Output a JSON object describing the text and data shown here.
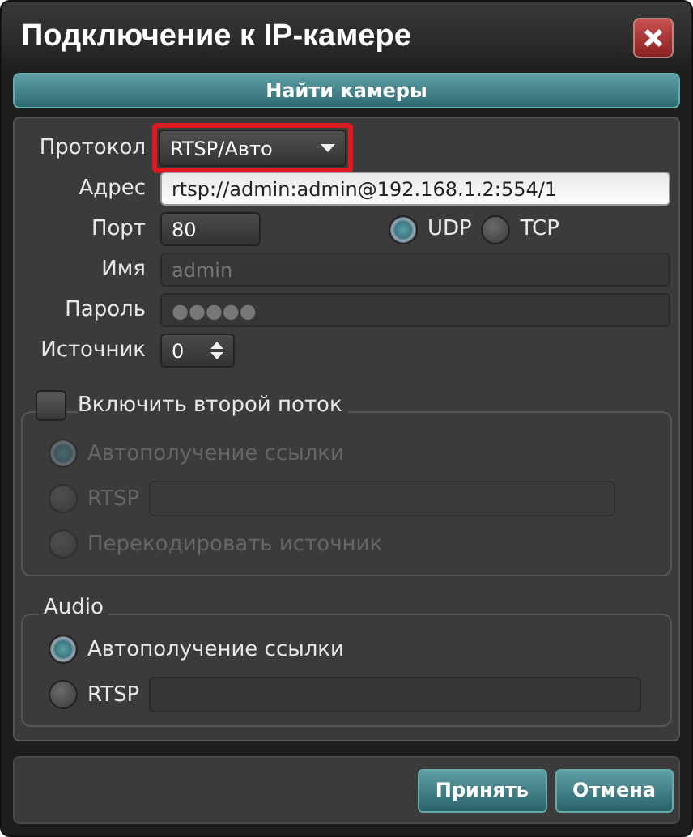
{
  "window": {
    "title": "Подключение к IP-камере"
  },
  "find_button": "Найти камеры",
  "fields": [
    {
      "kind": "dropdown",
      "label": "Протокол",
      "value": "RTSP/Авто",
      "highlighted": true
    },
    {
      "kind": "text",
      "label": "Адрес",
      "value": "rtsp://admin:admin@192.168.1.2:554/1",
      "disabled": false
    },
    {
      "kind": "port",
      "label": "Порт",
      "value": "80",
      "transport": [
        {
          "label": "UDP",
          "selected": true
        },
        {
          "label": "TCP",
          "selected": false
        }
      ]
    },
    {
      "kind": "text",
      "label": "Имя",
      "placeholder": "admin",
      "disabled": true
    },
    {
      "kind": "text",
      "label": "Пароль",
      "placeholder": "●●●●●",
      "disabled": true
    },
    {
      "kind": "spinner",
      "label": "Источник",
      "value": "0"
    }
  ],
  "second_stream": {
    "label": "Включить второй поток",
    "checked": false,
    "options": [
      {
        "kind": "radio",
        "label": "Автополучение ссылки",
        "selected": true
      },
      {
        "kind": "radio_field",
        "label": "RTSP",
        "selected": false
      },
      {
        "kind": "radio",
        "label": "Перекодировать источник",
        "selected": false
      }
    ]
  },
  "audio": {
    "title": "Audio",
    "options": [
      {
        "kind": "radio",
        "label": "Автополучение ссылки",
        "selected": true
      },
      {
        "kind": "radio_field",
        "label": "RTSP",
        "selected": false
      }
    ]
  },
  "buttons": [
    "Принять",
    "Отмена"
  ]
}
